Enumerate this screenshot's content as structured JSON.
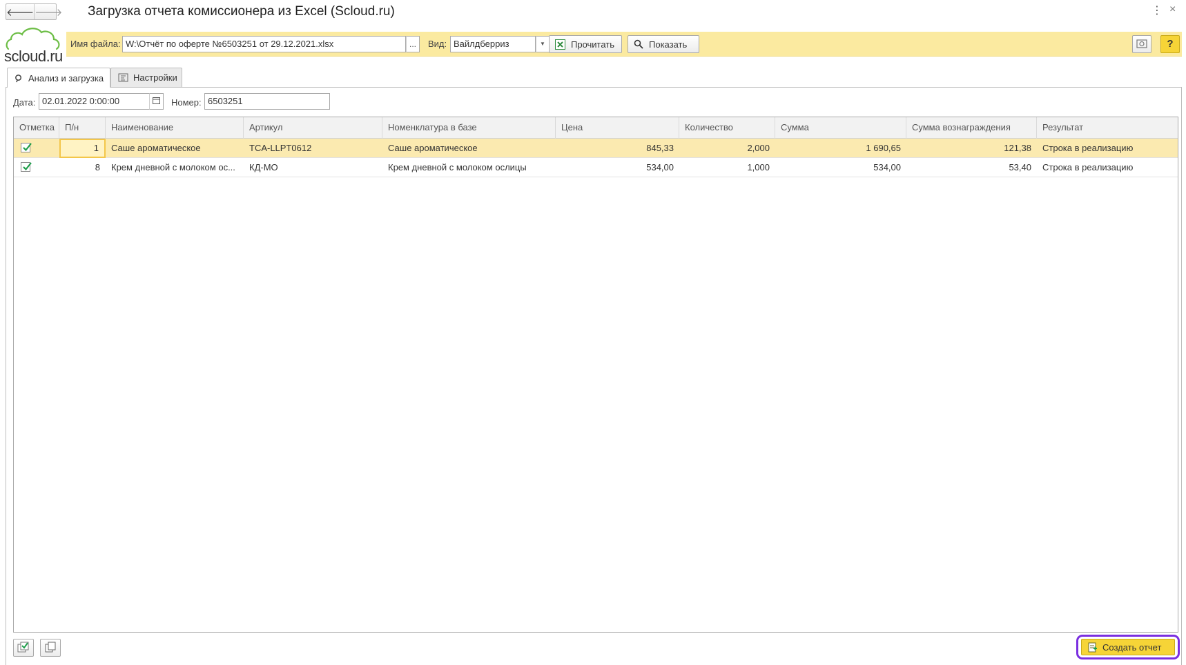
{
  "window": {
    "title": "Загрузка отчета комиссионера из Excel (Scloud.ru)",
    "more_glyph": "⋮",
    "close_glyph": "×"
  },
  "nav": {
    "back_glyph": "🡐",
    "forward_glyph": "🡒"
  },
  "logo": {
    "text": "scloud.ru"
  },
  "toolbar": {
    "file_label": "Имя файла:",
    "file_value": "W:\\Отчёт по оферте №6503251 от 29.12.2021.xlsx",
    "file_dots": "...",
    "view_label": "Вид:",
    "view_value": "Вайлдберриз",
    "read_label": "Прочитать",
    "show_label": "Показать",
    "help_label": "?"
  },
  "tabs": [
    {
      "label": "Анализ и загрузка",
      "icon": "search-icon",
      "active": true
    },
    {
      "label": "Настройки",
      "icon": "settings-icon",
      "active": false
    }
  ],
  "form": {
    "date_label": "Дата:",
    "date_value": "02.01.2022  0:00:00",
    "number_label": "Номер:",
    "number_value": "6503251"
  },
  "table": {
    "columns": [
      "Отметка",
      "П/н",
      "Наименование",
      "Артикул",
      "Номенклатура в базе",
      "Цена",
      "Количество",
      "Сумма",
      "Сумма вознаграждения",
      "Результат"
    ],
    "rows": [
      {
        "checked": true,
        "pn": "1",
        "name": "Саше ароматическое",
        "article": "TCA-LLPT0612",
        "nomenclature": "Саше ароматическое",
        "price": "845,33",
        "qty": "2,000",
        "sum": "1 690,65",
        "reward": "121,38",
        "result": "Строка в реализацию"
      },
      {
        "checked": true,
        "pn": "8",
        "name": "Крем дневной с молоком ос...",
        "article": "КД-МО",
        "nomenclature": "Крем дневной с молоком ослицы",
        "price": "534,00",
        "qty": "1,000",
        "sum": "534,00",
        "reward": "53,40",
        "result": "Строка в реализацию"
      }
    ]
  },
  "footer": {
    "create_label": "Создать отчет"
  },
  "colors": {
    "accent_yellow": "#f6d437",
    "toolbar_bg": "#fbeaa0",
    "selected_row": "#fbeab0",
    "highlight_border": "#7a2ee0",
    "check_green": "#1e9e4a"
  }
}
